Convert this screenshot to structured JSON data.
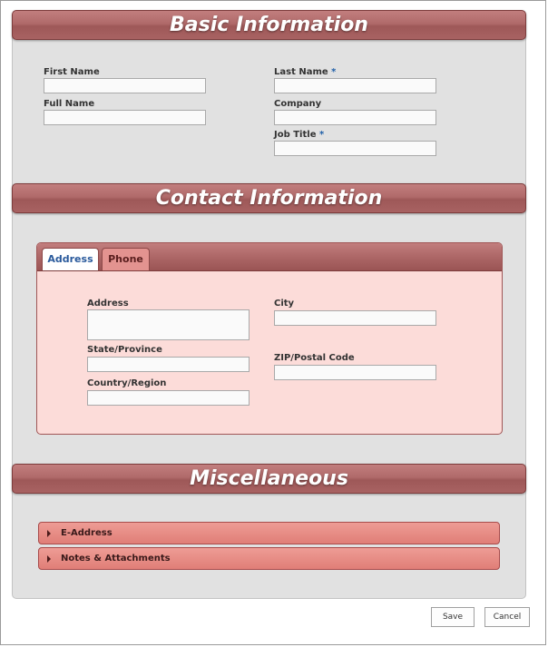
{
  "sections": {
    "basic": "Basic Information",
    "contact": "Contact Information",
    "misc": "Miscellaneous"
  },
  "basic": {
    "first_name": "First Name",
    "last_name": "Last Name",
    "full_name": "Full Name",
    "company": "Company",
    "job_title": "Job Title",
    "required_mark": "*"
  },
  "contact": {
    "tabs": [
      "Address",
      "Phone"
    ],
    "active_tab": "Address",
    "fields": {
      "address": "Address",
      "state": "State/Province",
      "country": "Country/Region",
      "city": "City",
      "zip": "ZIP/Postal Code"
    }
  },
  "misc": {
    "items": [
      "E-Address",
      "Notes & Attachments"
    ]
  },
  "buttons": {
    "save": "Save",
    "cancel": "Cancel"
  }
}
